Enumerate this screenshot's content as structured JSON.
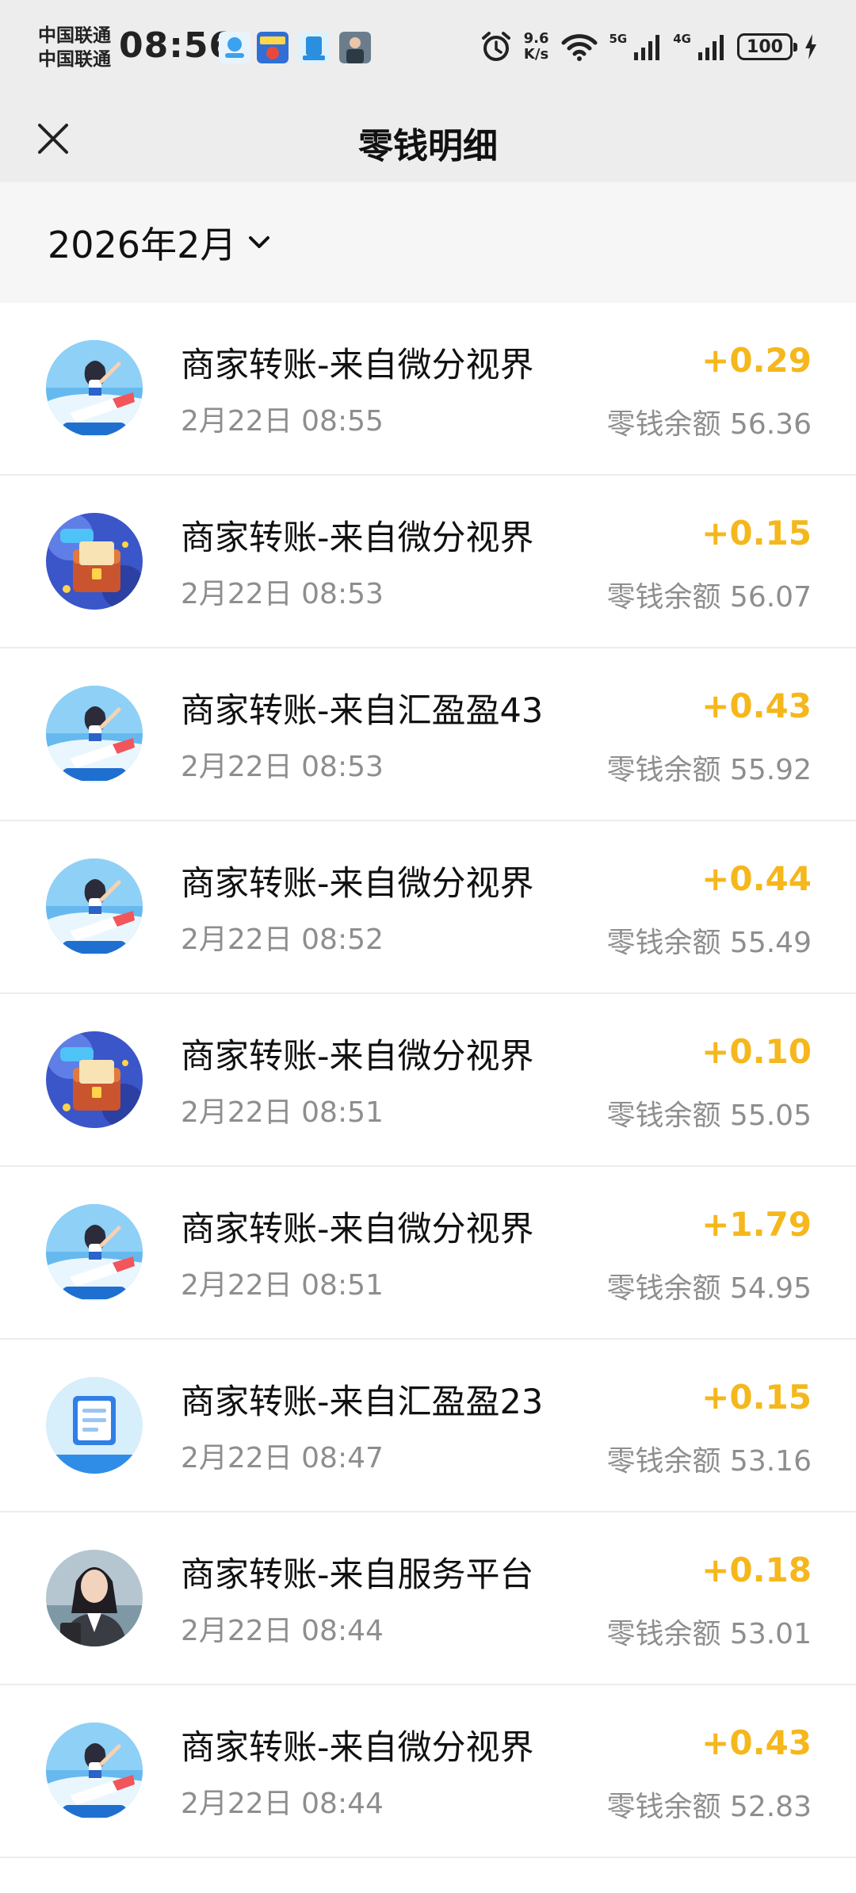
{
  "status_bar": {
    "carrier_1": "中国联通",
    "carrier_2": "中国联通",
    "time": "08:56",
    "speed_value": "9.6",
    "speed_unit": "K/s",
    "net_5g": "5G",
    "net_4g": "4G",
    "battery": "100"
  },
  "nav": {
    "title": "零钱明细"
  },
  "filter": {
    "month": "2026年2月"
  },
  "colors": {
    "amount": "#f5b71c",
    "secondary_text": "#8e8e8e",
    "header_bg": "#ededed",
    "month_bg": "#f6f6f6"
  },
  "transactions": [
    {
      "title": "商家转账-来自微分视界",
      "time": "2月22日 08:55",
      "amount": "+0.29",
      "balance": "零钱余额 56.36",
      "avatar": "qa-girl-avatar-icon"
    },
    {
      "title": "商家转账-来自微分视界",
      "time": "2月22日 08:53",
      "amount": "+0.15",
      "balance": "零钱余额 56.07",
      "avatar": "idiom-chest-avatar-icon"
    },
    {
      "title": "商家转账-来自汇盈盈43",
      "time": "2月22日 08:53",
      "amount": "+0.43",
      "balance": "零钱余额 55.92",
      "avatar": "qa-girl-avatar-icon"
    },
    {
      "title": "商家转账-来自微分视界",
      "time": "2月22日 08:52",
      "amount": "+0.44",
      "balance": "零钱余额 55.49",
      "avatar": "qa-girl-avatar-icon"
    },
    {
      "title": "商家转账-来自微分视界",
      "time": "2月22日 08:51",
      "amount": "+0.10",
      "balance": "零钱余额 55.05",
      "avatar": "idiom-chest-avatar-icon"
    },
    {
      "title": "商家转账-来自微分视界",
      "time": "2月22日 08:51",
      "amount": "+1.79",
      "balance": "零钱余额 54.95",
      "avatar": "qa-girl-avatar-icon"
    },
    {
      "title": "商家转账-来自汇盈盈23",
      "time": "2月22日 08:47",
      "amount": "+0.15",
      "balance": "零钱余额 53.16",
      "avatar": "book-avatar-icon"
    },
    {
      "title": "商家转账-来自服务平台",
      "time": "2月22日 08:44",
      "amount": "+0.18",
      "balance": "零钱余额 53.01",
      "avatar": "business-woman-avatar-icon"
    },
    {
      "title": "商家转账-来自微分视界",
      "time": "2月22日 08:44",
      "amount": "+0.43",
      "balance": "零钱余额 52.83",
      "avatar": "qa-girl-avatar-icon"
    }
  ]
}
